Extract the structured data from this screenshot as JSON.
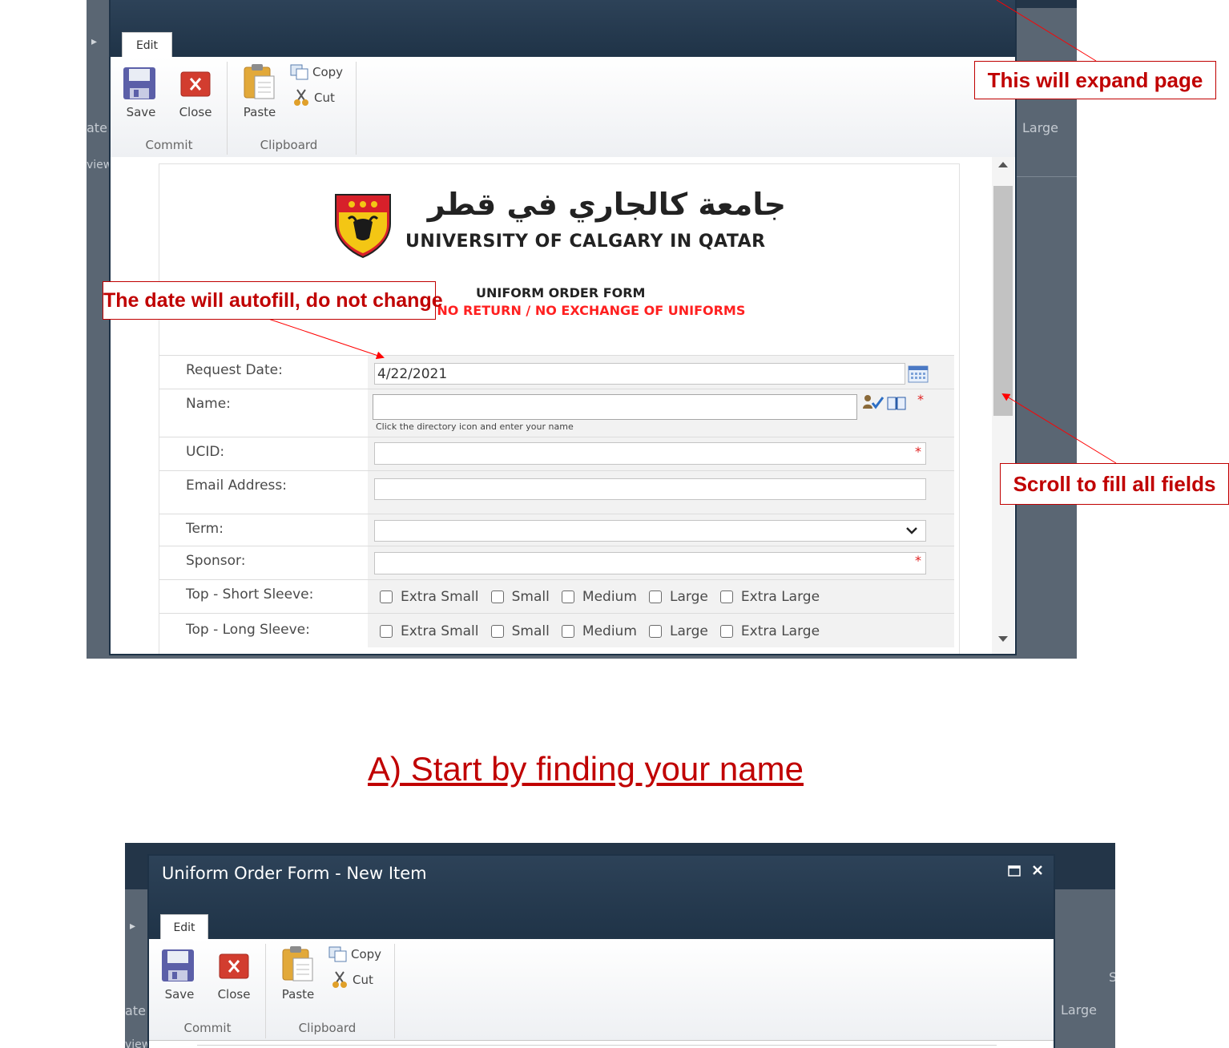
{
  "dialog_top": {
    "tab_label": "Edit",
    "commit": {
      "save_label": "Save",
      "close_label": "Close",
      "group_label": "Commit"
    },
    "clipboard": {
      "paste_label": "Paste",
      "copy_label": "Copy",
      "cut_label": "Cut",
      "group_label": "Clipboard"
    },
    "bg_fragments": {
      "left_1": "ate",
      "left_2": "view",
      "right_1": "Large"
    }
  },
  "form": {
    "arabic_name": "جامعة كالجاري في قطر",
    "university_name": "UNIVERSITY OF CALGARY IN QATAR",
    "form_title": "UNIFORM ORDER FORM",
    "subtitle": "/ NO RETURN / NO EXCHANGE OF UNIFORMS",
    "fields": {
      "request_date": {
        "label": "Request Date:",
        "value": "4/22/2021"
      },
      "name": {
        "label": "Name:",
        "value": "",
        "hint": "Click the directory icon and enter your name"
      },
      "ucid": {
        "label": "UCID:",
        "value": ""
      },
      "email": {
        "label": "Email Address:",
        "value": ""
      },
      "term": {
        "label": "Term:",
        "value": ""
      },
      "sponsor": {
        "label": "Sponsor:",
        "value": ""
      },
      "top_short": {
        "label": "Top - Short Sleeve:"
      },
      "top_long": {
        "label": "Top - Long Sleeve:"
      }
    },
    "sizes": [
      "Extra Small",
      "Small",
      "Medium",
      "Large",
      "Extra Large"
    ],
    "required_marker": "*"
  },
  "annotations": {
    "expand": "This will expand page",
    "autofill": "The date will autofill, do not change",
    "scroll": "Scroll to fill all fields"
  },
  "heading": "A) Start by finding your name",
  "dialog_bottom": {
    "title": "Uniform Order Form - New Item",
    "tab_label": "Edit",
    "commit": {
      "save_label": "Save",
      "close_label": "Close",
      "group_label": "Commit"
    },
    "clipboard": {
      "paste_label": "Paste",
      "copy_label": "Copy",
      "cut_label": "Cut",
      "group_label": "Clipboard"
    },
    "bg_fragments": {
      "left_1": "ate",
      "left_2": "view",
      "right_1": "Large",
      "right_2": "S"
    }
  },
  "colors": {
    "annotation_red": "#c00000",
    "dialog_header": "#1f3347",
    "backdrop": "#5a6673"
  }
}
